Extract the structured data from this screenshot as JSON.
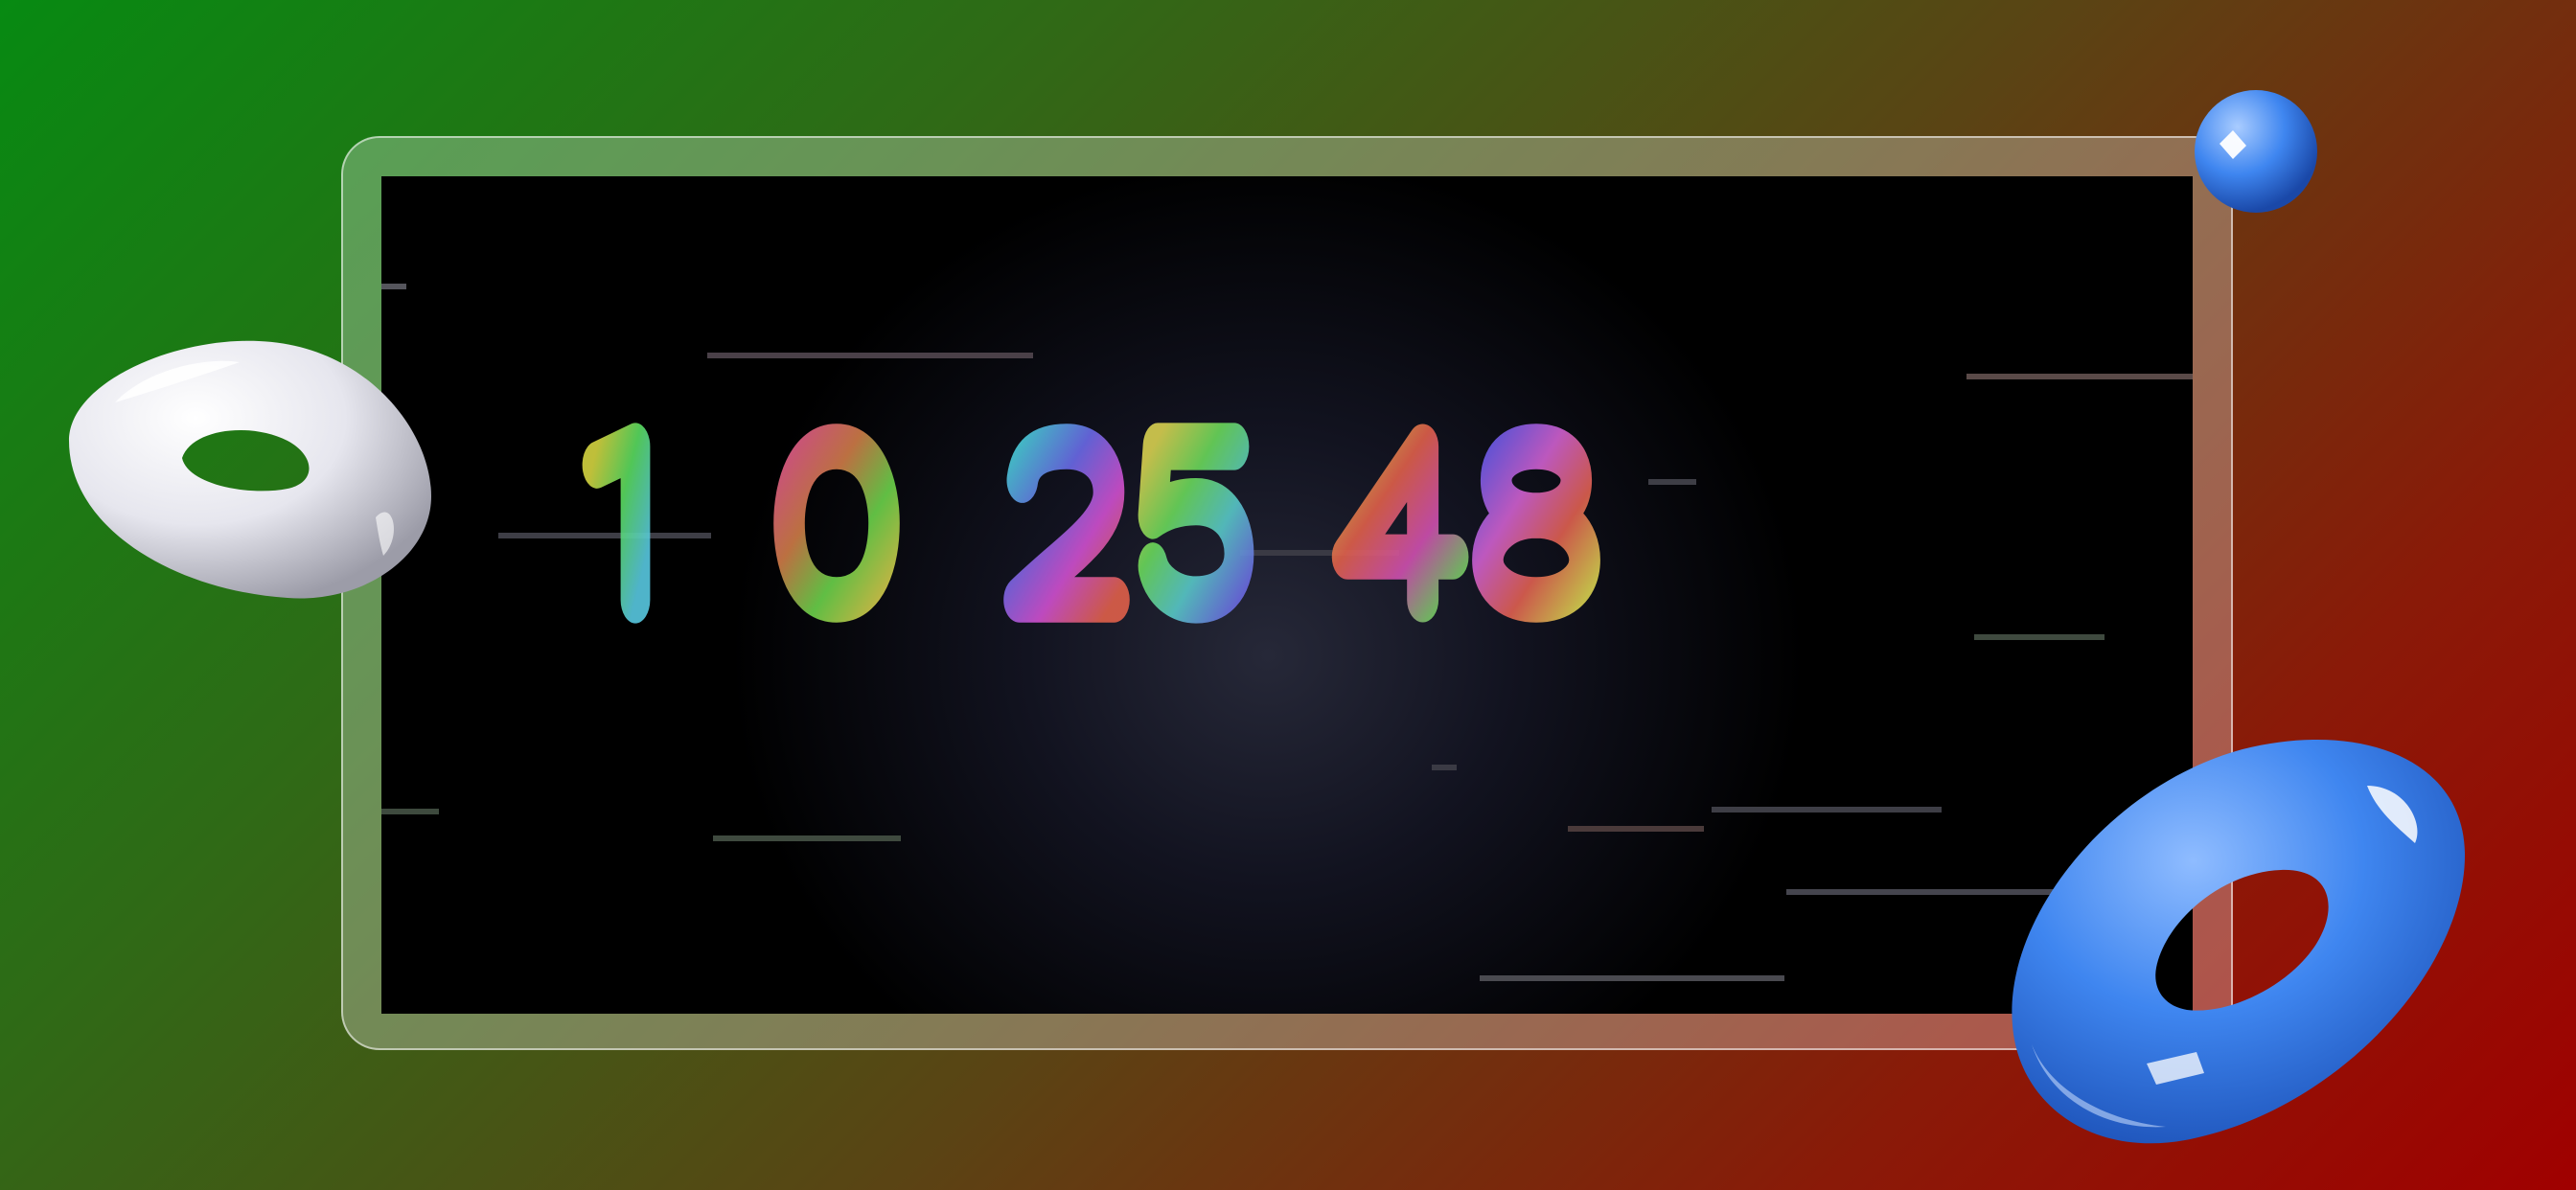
{
  "display": {
    "digits": [
      "1",
      "0",
      "2",
      "5",
      "4",
      "8"
    ],
    "groups": [
      "10",
      "25",
      "48"
    ]
  },
  "decor": {
    "rings": [
      {
        "name": "white-torus",
        "color": "#f2f2f6"
      },
      {
        "name": "blue-torus",
        "color": "#3f86f0"
      }
    ],
    "sphere_color": "#3f86f0"
  },
  "colors": {
    "display_bg": "#000000",
    "streak": "#5a5560",
    "bg_start": "#078a12",
    "bg_end": "#a00000"
  }
}
